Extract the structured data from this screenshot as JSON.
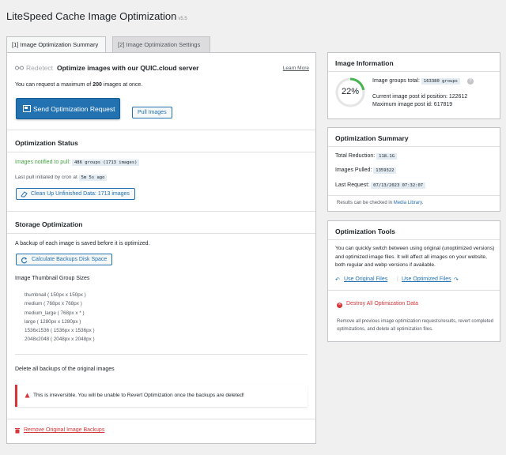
{
  "header": {
    "title": "LiteSpeed Cache Image Optimization",
    "version": "v5.5"
  },
  "tabs": [
    {
      "label": "[1] Image Optimization Summary",
      "active": true
    },
    {
      "label": "[2] Image Optimization Settings",
      "active": false
    }
  ],
  "request": {
    "redetect": "Redetect",
    "heading": "Optimize images with our QUIC.cloud server",
    "learn_more": "Learn More",
    "max_text_pre": "You can request a maximum of",
    "max_count": "200",
    "max_text_post": "images at once.",
    "send_button": "Send Optimization Request",
    "pull_button": "Pull Images"
  },
  "status": {
    "title": "Optimization Status",
    "notified_label": "Images notified to pull:",
    "notified_value": "486 groups (1713 images)",
    "last_pull_label": "Last pull initiated by cron at",
    "last_pull_value": "5m 5s ago",
    "clean_button": "Clean Up Unfinished Data: 1713 images"
  },
  "storage": {
    "title": "Storage Optimization",
    "backup_note": "A backup of each image is saved before it is optimized.",
    "calc_button": "Calculate Backups Disk Space",
    "sizes_title": "Image Thumbnail Group Sizes",
    "sizes": [
      "thumbnail ( 150px x 150px )",
      "medium ( 768px x 768px )",
      "medium_large ( 768px x * )",
      "large ( 1280px x 1280px )",
      "1536x1536 ( 1536px x 1536px )",
      "2048x2048 ( 2048px x 2048px )"
    ],
    "delete_title": "Delete all backups of the original images",
    "warning": "This is irreversible. You will be unable to Revert Optimization once the backups are deleted!",
    "remove_link": "Remove Original Image Backups"
  },
  "info": {
    "title": "Image Information",
    "percent": "22%",
    "progress_fraction": 0.22,
    "groups_label": "Image groups total:",
    "groups_value": "163380 groups",
    "current_pos": "Current image post id position: 122612",
    "max_id": "Maximum image post id: 617819"
  },
  "summary": {
    "title": "Optimization Summary",
    "reduction_label": "Total Reduction:",
    "reduction_value": "118.1G",
    "pulled_label": "Images Pulled:",
    "pulled_value": "1359322",
    "last_request_label": "Last Request:",
    "last_request_value": "07/13/2023 07:32:07",
    "note_pre": "Results can be checked in",
    "note_link": "Media Library",
    "note_post": "."
  },
  "tools": {
    "title": "Optimization Tools",
    "desc": "You can quickly switch between using original (unoptimized versions) and optimized image files. It will affect all images on your website, both regular and webp versions if available.",
    "use_original": "Use Original Files",
    "use_optimized": "Use Optimized Files",
    "destroy": "Destroy All Optimization Data",
    "destroy_desc": "Remove all previous image optimization requests/results, revert completed optimizations, and delete all optimization files."
  },
  "colors": {
    "accent": "#2271b1",
    "button": "#2271b1",
    "progress": "#46b450",
    "danger": "#d63638"
  }
}
